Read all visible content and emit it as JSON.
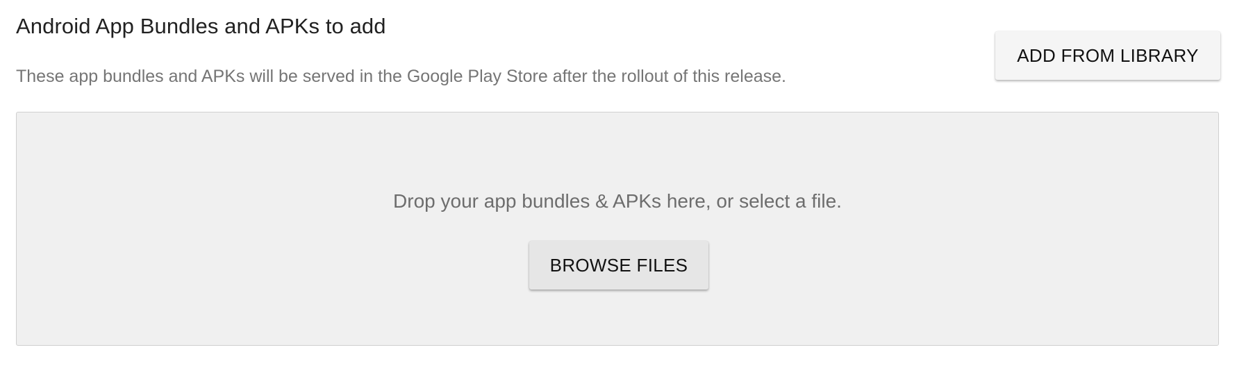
{
  "section": {
    "title": "Android App Bundles and APKs to add",
    "subtitle": "These app bundles and APKs will be served in the Google Play Store after the rollout of this release.",
    "add_from_library_label": "ADD FROM LIBRARY"
  },
  "dropzone": {
    "prompt": "Drop your app bundles & APKs here, or select a file.",
    "browse_label": "BROWSE FILES"
  },
  "colors": {
    "background": "#ffffff",
    "dropzone_background": "#f0f0f0",
    "dropzone_border": "#cfcfcf",
    "title_text": "#212121",
    "secondary_text": "#757575",
    "button_background": "#f5f5f5"
  }
}
